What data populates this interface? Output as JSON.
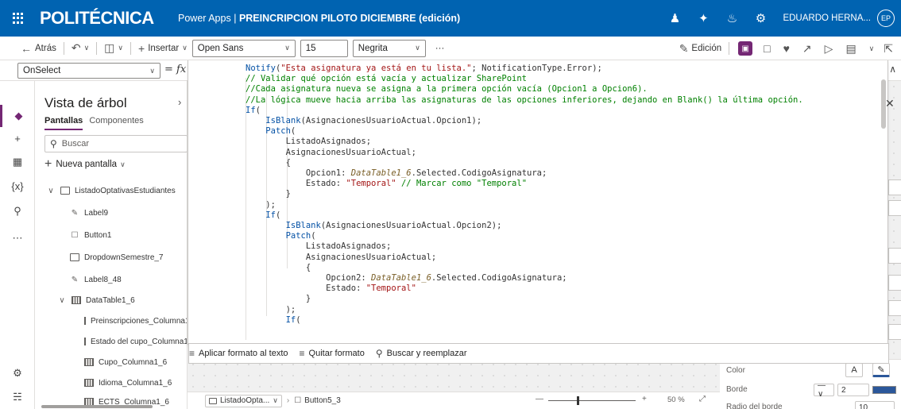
{
  "topbar": {
    "brand": "POLITÉCNICA",
    "app_name": "Power Apps",
    "separator": "|",
    "app_title": "PREINCRIPCION PILOTO DICIEMBRE (edición)",
    "user_name": "EDUARDO HERNA...",
    "avatar_initials": "EP"
  },
  "toolbar": {
    "back": "Atrás",
    "insert": "Insertar",
    "font": "Open Sans",
    "font_size": "15",
    "font_weight": "Negrita",
    "more": "···",
    "edit": "Edición"
  },
  "formula": {
    "property": "OnSelect",
    "eq": "=",
    "fx": "fx",
    "code_lines": [
      "Notify(\"Esta asignatura ya está en tu lista.\"; NotificationType.Error);",
      "// Validar qué opción está vacía y actualizar SharePoint",
      "//Cada asignatura nueva se asigna a la primera opción vacía (Opcion1 a Opcion6).",
      "//La lógica mueve hacia arriba las asignaturas de las opciones inferiores, dejando en Blank() la última opción.",
      "If(",
      "    IsBlank(AsignacionesUsuarioActual.Opcion1);",
      "    Patch(",
      "        ListadoAsignados;",
      "        AsignacionesUsuarioActual;",
      "        {",
      "            Opcion1: DataTable1_6.Selected.CodigoAsignatura;",
      "            Estado: \"Temporal\" // Marcar como \"Temporal\"",
      "        }",
      "    );",
      "    If(",
      "        IsBlank(AsignacionesUsuarioActual.Opcion2);",
      "        Patch(",
      "            ListadoAsignados;",
      "            AsignacionesUsuarioActual;",
      "            {",
      "                Opcion2: DataTable1_6.Selected.CodigoAsignatura;",
      "                Estado: \"Temporal\"",
      "            }",
      "        );",
      "        If("
    ],
    "tools": {
      "format": "Aplicar formato al texto",
      "remove": "Quitar formato",
      "find": "Buscar y reemplazar"
    }
  },
  "tree": {
    "title": "Vista de árbol",
    "tab_screens": "Pantallas",
    "tab_components": "Componentes",
    "search_placeholder": "Buscar",
    "new_screen": "Nueva pantalla",
    "items": [
      {
        "label": "ListadoOptativasEstudiantes",
        "kind": "screen"
      },
      {
        "label": "Label9",
        "kind": "label"
      },
      {
        "label": "Button1",
        "kind": "button"
      },
      {
        "label": "DropdownSemestre_7",
        "kind": "dropdown"
      },
      {
        "label": "Label8_48",
        "kind": "label"
      },
      {
        "label": "DataTable1_6",
        "kind": "table"
      },
      {
        "label": "Preinscripciones_Columna1",
        "kind": "column"
      },
      {
        "label": "Estado del cupo_Columna1",
        "kind": "column"
      },
      {
        "label": "Cupo_Columna1_6",
        "kind": "column"
      },
      {
        "label": "Idioma_Columna1_6",
        "kind": "column"
      },
      {
        "label": "ECTS_Columna1_6",
        "kind": "column"
      }
    ]
  },
  "properties": {
    "color": "Color",
    "border": "Borde",
    "border_value": "2",
    "border_radius": "Radio del borde",
    "border_radius_value": "10",
    "a_glyph": "A",
    "swatch_color": "#2b579a"
  },
  "status": {
    "screen": "ListadoOpta...",
    "control": "Button5_3",
    "zoom_minus": "—",
    "zoom_plus": "+",
    "zoom": "50 %"
  },
  "colors": {
    "topbar": "#0063b1",
    "accent": "#742774"
  }
}
